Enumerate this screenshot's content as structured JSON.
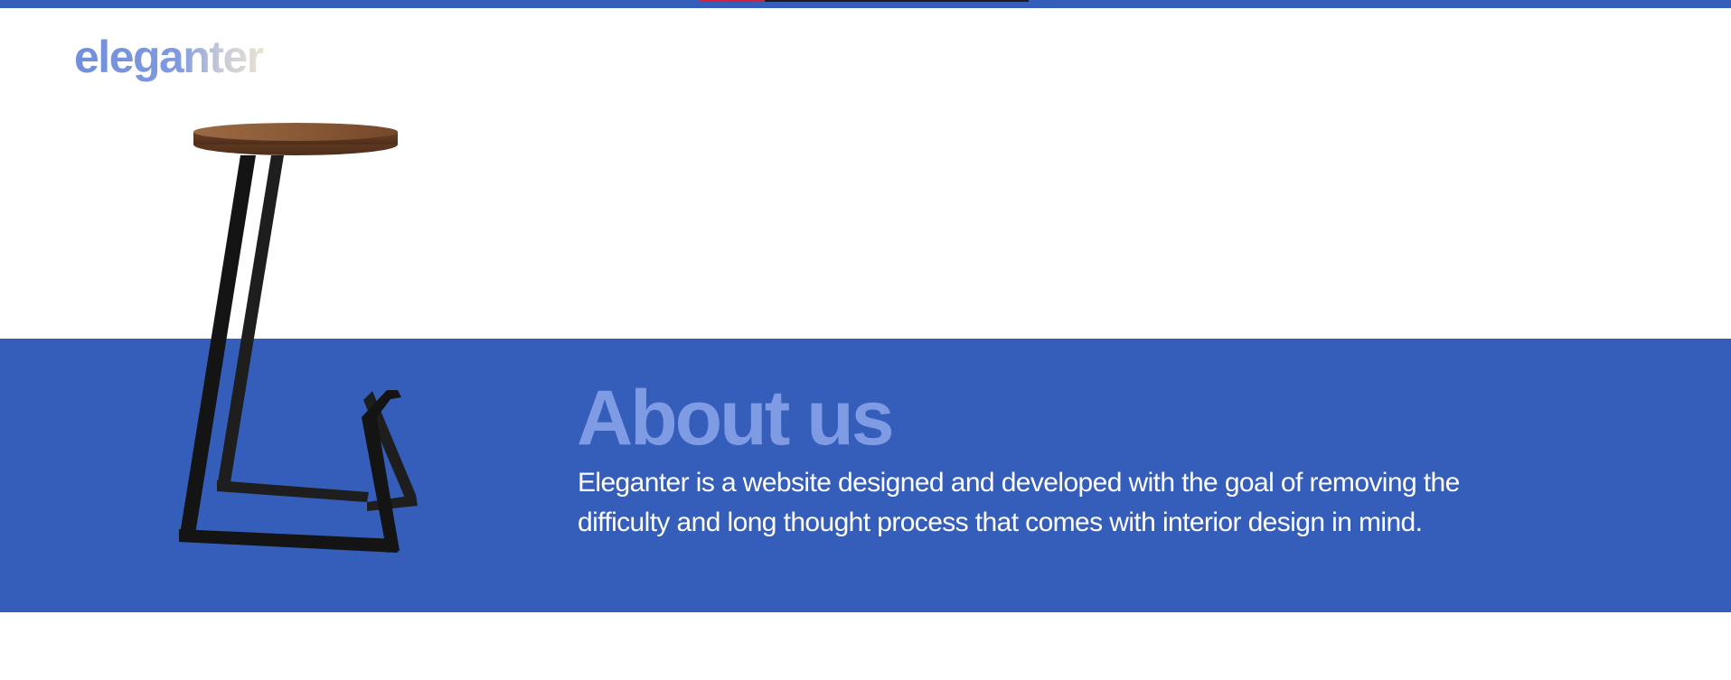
{
  "colors": {
    "brand_blue": "#355dba",
    "title_light_blue": "#7f9be3",
    "text_white": "#ffffff"
  },
  "header": {
    "logo": "eleganter"
  },
  "about": {
    "title": "About us",
    "description": "Eleganter is a website designed and developed  with the goal of removing the difficulty and long thought process that comes with interior design in mind."
  },
  "hero_image": {
    "subject": "wooden-seat-metal-frame-stool"
  }
}
